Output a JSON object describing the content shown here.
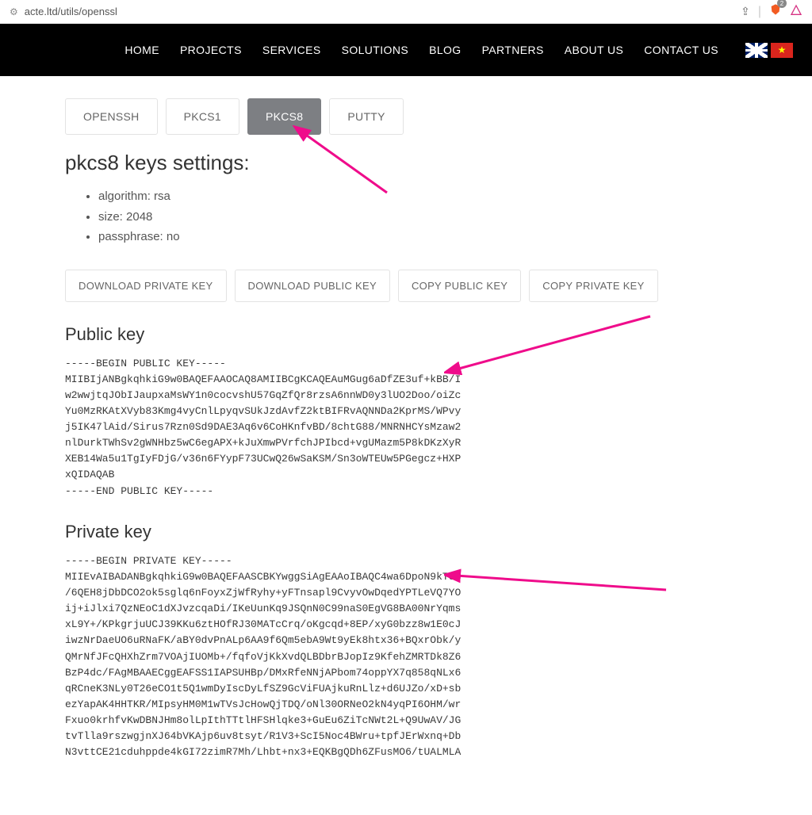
{
  "browser": {
    "url": "acte.ltd/utils/openssl",
    "shield_count": "2"
  },
  "nav": {
    "items": [
      "HOME",
      "PROJECTS",
      "SERVICES",
      "SOLUTIONS",
      "BLOG",
      "PARTNERS",
      "ABOUT US",
      "CONTACT US"
    ]
  },
  "tabs": [
    {
      "label": "OPENSSH",
      "active": false
    },
    {
      "label": "PKCS1",
      "active": false
    },
    {
      "label": "PKCS8",
      "active": true
    },
    {
      "label": "PUTTY",
      "active": false
    }
  ],
  "settings": {
    "title": "pkcs8 keys settings:",
    "items": [
      "algorithm: rsa",
      "size: 2048",
      "passphrase: no"
    ]
  },
  "actions": {
    "download_private": "DOWNLOAD PRIVATE KEY",
    "download_public": "DOWNLOAD PUBLIC KEY",
    "copy_public": "COPY PUBLIC KEY",
    "copy_private": "COPY PRIVATE KEY"
  },
  "sections": {
    "public_title": "Public key",
    "private_title": "Private key"
  },
  "keys": {
    "public": "-----BEGIN PUBLIC KEY-----\nMIIBIjANBgkqhkiG9w0BAQEFAAOCAQ8AMIIBCgKCAQEAuMGug6aDfZE3uf+kBB/I\nw2wwjtqJObIJaupxaMsWY1n0cocvshU57GqZfQr8rzsA6nnWD0y3lUO2Doo/oiZc\nYu0MzRKAtXVyb83Kmg4vyCnlLpyqvSUkJzdAvfZ2ktBIFRvAQNNDa2KprMS/WPvy\nj5IK47lAid/Sirus7Rzn0Sd9DAE3Aq6v6CoHKnfvBD/8chtG88/MNRNHCYsMzaw2\nnlDurkTWhSv2gWNHbz5wC6egAPX+kJuXmwPVrfchJPIbcd+vgUMazm5P8kDKzXyR\nXEB14Wa5u1TgIyFDjG/v36n6FYypF73UCwQ26wSaKSM/Sn3oWTEUw5PGegcz+HXP\nxQIDAQAB\n-----END PUBLIC KEY-----",
    "private": "-----BEGIN PRIVATE KEY-----\nMIIEvAIBADANBgkqhkiG9w0BAQEFAASCBKYwggSiAgEAAoIBAQC4wa6DpoN9kTe5\n/6QEH8jDbDCO2ok5sglq6nFoyxZjWfRyhy+yFTnsapl9CvyvOwDqedYPTLeVQ7YO\nij+iJlxi7QzNEoC1dXJvzcqaDi/IKeUunKq9JSQnN0C99naS0EgVG8BA00NrYqms\nxL9Y+/KPkgrjuUCJ39KKu6ztHOfRJ30MATcCrq/oKgcqd+8EP/xyG0bzz8w1E0cJ\niwzNrDaeUO6uRNaFK/aBY0dvPnALp6AA9f6Qm5ebA9Wt9yEk8htx36+BQxrObk/y\nQMrNfJFcQHXhZrm7VOAjIUOMb+/fqfoVjKkXvdQLBDbrBJopIz9KfehZMRTDk8Z6\nBzP4dc/FAgMBAAECggEAFSS1IAPSUHBp/DMxRfeNNjAPbom74oppYX7q858qNLx6\nqRCneK3NLy0T26eCO1t5Q1wmDyIscDyLfSZ9GcViFUAjkuRnLlz+d6UJZo/xD+sb\nezYapAK4HHTKR/MIpsyHM0M1wTVsJcHowQjTDQ/oNl30ORNeO2kN4yqPI6OHM/wr\nFxuo0krhfvKwDBNJHm8olLpIthTTtlHFSHlqke3+GuEu6ZiTcNWt2L+Q9UwAV/JG\ntvTlla9rszwgjnXJ64bVKAjp6uv8tsyt/R1V3+ScI5Noc4BWru+tpfJErWxnq+Db\nN3vttCE21cduhppde4kGI72zimR7Mh/Lhbt+nx3+EQKBgQDh6ZFusMO6/tUALMLA"
  }
}
